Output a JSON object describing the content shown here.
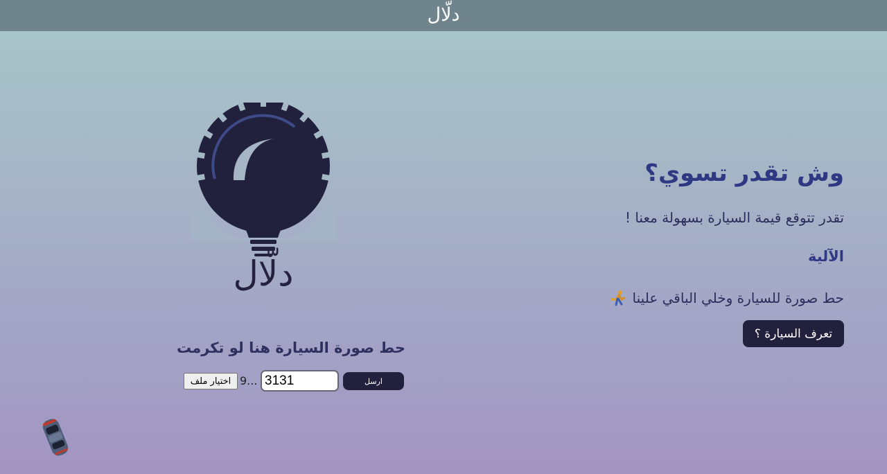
{
  "header": {
    "title": "دلّال"
  },
  "logo": {
    "text": "دلّال",
    "colors": {
      "bulb": "#22213d",
      "accent": "#3f4a88"
    }
  },
  "upload": {
    "heading": "حط صورة السيارة هنا لو تكرمت",
    "file_button_label": "اختيار ملف",
    "file_name": "9...",
    "code_value": "3131",
    "send_label": "ارسل"
  },
  "info": {
    "heading": "وش تقدر تسوي؟",
    "description": "تقدر تتوقع قيمة السيارة بسهولة معنا !",
    "mechanism_heading": "الآلية",
    "mechanism_text": "حط صورة للسيارة وخلي الباقي علينا",
    "mechanism_icon": "running-person-icon",
    "know_car_label": "تعرف السيارة ؟"
  },
  "colors": {
    "topbar": "#6f848d",
    "accent_text": "#2f3882",
    "button": "#22213d"
  }
}
